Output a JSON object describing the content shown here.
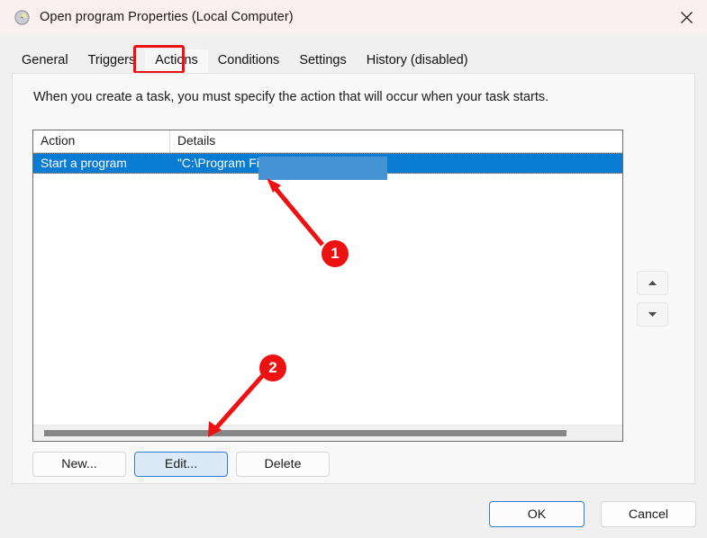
{
  "window": {
    "title": "Open program Properties (Local Computer)",
    "icon": "clock-icon",
    "close_label": "✕"
  },
  "tabs": [
    {
      "label": "General",
      "active": false
    },
    {
      "label": "Triggers",
      "active": false
    },
    {
      "label": "Actions",
      "active": true
    },
    {
      "label": "Conditions",
      "active": false
    },
    {
      "label": "Settings",
      "active": false
    },
    {
      "label": "History (disabled)",
      "active": false
    }
  ],
  "panel": {
    "intro": "When you create a task, you must specify the action that will occur when your task starts."
  },
  "list": {
    "columns": [
      "Action",
      "Details"
    ],
    "rows": [
      {
        "action": "Start a program",
        "details": "\"C:\\Program Files\\Par",
        "selected": true,
        "redacted": true
      }
    ]
  },
  "move_buttons": {
    "up": "▲",
    "down": "▼"
  },
  "action_buttons": {
    "new": "New...",
    "edit": "Edit...",
    "delete": "Delete"
  },
  "footer_buttons": {
    "ok": "OK",
    "cancel": "Cancel"
  },
  "annotations": [
    {
      "id": "1",
      "label": "1"
    },
    {
      "id": "2",
      "label": "2"
    }
  ],
  "colors": {
    "titlebar": "#fbf0f0",
    "panel": "#f8f8f8",
    "dialog": "#f0f0f0",
    "selection": "#0a7cd4",
    "redaction": "#4593d4",
    "accent": "#2d7dd2",
    "annotation": "#ee1111",
    "scroll_thumb": "#868686"
  }
}
